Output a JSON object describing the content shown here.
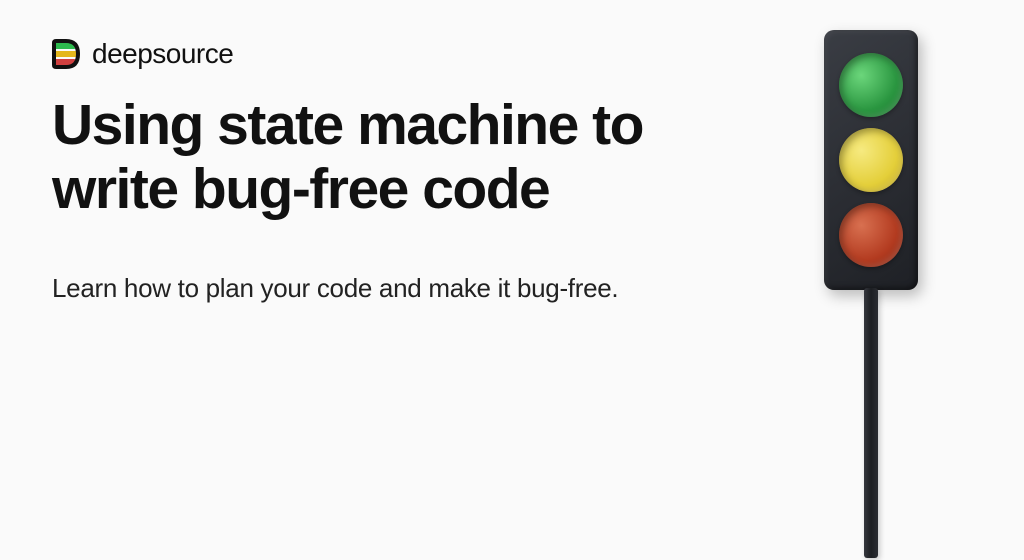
{
  "brand": {
    "name": "deepsource"
  },
  "headline": "Using state machine to write bug-free code",
  "subheadline": "Learn how to plan your code and make it bug-free.",
  "illustration": {
    "name": "traffic-light",
    "lights": [
      "green",
      "yellow",
      "red"
    ]
  }
}
